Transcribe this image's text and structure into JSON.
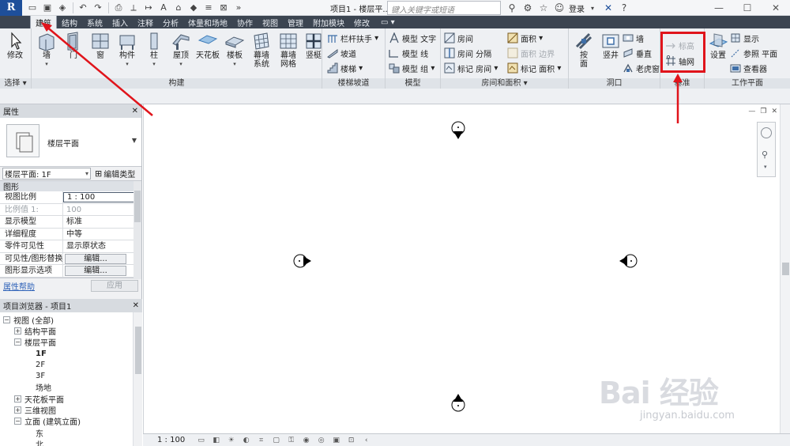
{
  "window": {
    "title": "项目1 - 楼层平...",
    "search_placeholder": "键入关键字或短语",
    "login_label": "登录",
    "app_letter": "R"
  },
  "tabs": [
    {
      "label": "建筑",
      "active": true
    },
    {
      "label": "结构"
    },
    {
      "label": "系统"
    },
    {
      "label": "插入"
    },
    {
      "label": "注释"
    },
    {
      "label": "分析"
    },
    {
      "label": "体量和场地"
    },
    {
      "label": "协作"
    },
    {
      "label": "视图"
    },
    {
      "label": "管理"
    },
    {
      "label": "附加模块"
    },
    {
      "label": "修改"
    }
  ],
  "ribbon": {
    "select": {
      "modify": "修改",
      "title": "选择"
    },
    "build": {
      "title": "构建",
      "buttons": [
        "墙",
        "门",
        "窗",
        "构件",
        "柱",
        "屋顶",
        "天花板",
        "楼板",
        "幕墙\n系统",
        "幕墙\n网格",
        "竖梃"
      ]
    },
    "stairs": {
      "title": "楼梯坡道",
      "railing": "栏杆扶手",
      "ramp": "坡道",
      "stair": "楼梯"
    },
    "model": {
      "title": "模型",
      "text": "模型 文字",
      "line": "模型 线",
      "group": "模型 组"
    },
    "room": {
      "title": "房间和面积",
      "room": "房间",
      "separator": "房间 分隔",
      "tag_room": "标记 房间",
      "area": "面积",
      "area_boundary": "面积 边界",
      "tag_area": "标记 面积"
    },
    "opening": {
      "title": "洞口",
      "by_face": "按\n面",
      "shaft": "竖井",
      "wall": "墙",
      "vertical": "垂直",
      "dormer": "老虎窗"
    },
    "datum": {
      "title": "基准",
      "level": "标高",
      "grid": "轴网"
    },
    "workplane": {
      "title": "工作平面",
      "set": "设置",
      "show": "显示",
      "ref_plane": "参照 平面",
      "viewer": "查看器"
    }
  },
  "properties": {
    "title": "属性",
    "type_name": "楼层平面",
    "instance_label": "楼层平面: 1F",
    "edit_type": "编辑类型",
    "group_name": "图形",
    "rows": [
      {
        "name": "视图比例",
        "value": "1 : 100",
        "input": true
      },
      {
        "name": "比例值 1:",
        "value": "100",
        "dim": true
      },
      {
        "name": "显示模型",
        "value": "标准"
      },
      {
        "name": "详细程度",
        "value": "中等"
      },
      {
        "name": "零件可见性",
        "value": "显示原状态"
      },
      {
        "name": "可见性/图形替换",
        "value": "编辑...",
        "button": true
      },
      {
        "name": "图形显示选项",
        "value": "编辑...",
        "button": true
      }
    ],
    "help_link": "属性帮助",
    "apply": "应用"
  },
  "browser": {
    "title": "项目浏览器 - 项目1",
    "nodes": [
      {
        "label": "视图 (全部)",
        "indent": 0,
        "toggle": "⊟"
      },
      {
        "label": "结构平面",
        "indent": 1,
        "toggle": "+"
      },
      {
        "label": "楼层平面",
        "indent": 1,
        "toggle": "−"
      },
      {
        "label": "1F",
        "indent": 2,
        "bold": true
      },
      {
        "label": "2F",
        "indent": 2
      },
      {
        "label": "3F",
        "indent": 2
      },
      {
        "label": "场地",
        "indent": 2
      },
      {
        "label": "天花板平面",
        "indent": 1,
        "toggle": "+"
      },
      {
        "label": "三维视图",
        "indent": 1,
        "toggle": "+"
      },
      {
        "label": "立面 (建筑立面)",
        "indent": 1,
        "toggle": "−"
      },
      {
        "label": "东",
        "indent": 2
      },
      {
        "label": "北",
        "indent": 2
      }
    ]
  },
  "statusbar": {
    "scale": "1 : 100"
  },
  "colors": {
    "highlight": "#e0141b",
    "tab_bar": "#3c4551",
    "ribbon": "#eef0f3"
  },
  "watermark": {
    "logo": "Bai 经验",
    "url": "jingyan.baidu.com"
  }
}
